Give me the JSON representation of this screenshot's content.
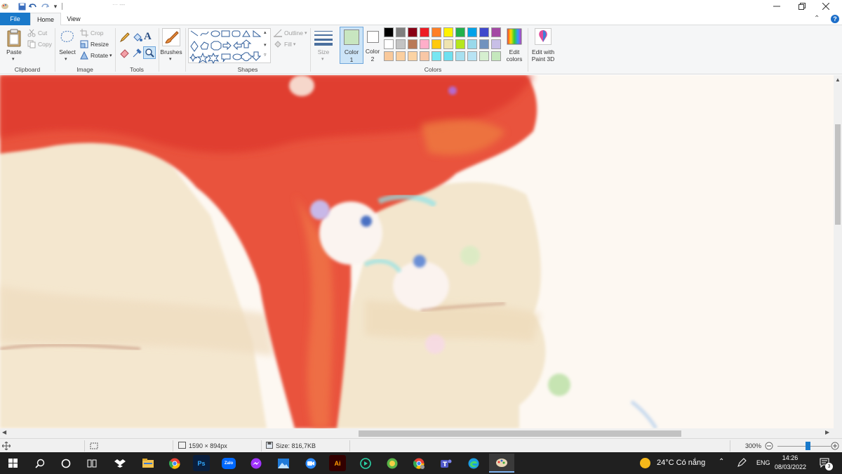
{
  "app": {
    "title_fragment": "··· ---"
  },
  "tabs": {
    "file": "File",
    "home": "Home",
    "view": "View"
  },
  "ribbon": {
    "clipboard": {
      "group_label": "Clipboard",
      "paste": "Paste",
      "cut": "Cut",
      "copy": "Copy"
    },
    "image": {
      "group_label": "Image",
      "select": "Select",
      "crop": "Crop",
      "resize": "Resize",
      "rotate": "Rotate"
    },
    "tools": {
      "group_label": "Tools",
      "text_tool": "A"
    },
    "brushes": {
      "label": "Brushes"
    },
    "shapes": {
      "group_label": "Shapes",
      "outline": "Outline",
      "fill": "Fill"
    },
    "size": {
      "label": "Size"
    },
    "colors": {
      "group_label": "Colors",
      "color1_label": "Color",
      "color1_num": "1",
      "color2_label": "Color",
      "color2_num": "2",
      "edit_colors_1": "Edit",
      "edit_colors_2": "colors",
      "edit_paint3d_1": "Edit with",
      "edit_paint3d_2": "Paint 3D",
      "color1_value": "#c8e6c0",
      "color2_value": "#ffffff",
      "row1": [
        "#000000",
        "#7f7f7f",
        "#880015",
        "#ed1c24",
        "#ff7f27",
        "#fff200",
        "#22b14c",
        "#00a2e8",
        "#3f48cc",
        "#a349a4"
      ],
      "row2": [
        "#ffffff",
        "#c3c3c3",
        "#b97a57",
        "#ffaec9",
        "#ffc90e",
        "#efe4b0",
        "#b5e61d",
        "#99d9ea",
        "#7092be",
        "#c8bfe7"
      ],
      "row3": [
        "#f9c99b",
        "#fbcf9f",
        "#fbd3a4",
        "#f9c7a6",
        "#77e6f2",
        "#6fe0f0",
        "#a8e0f0",
        "#b8e3f4",
        "#d6efd0",
        "#c5e8bd"
      ]
    }
  },
  "status": {
    "dimensions": "1590 × 894px",
    "size": "Size: 816,7KB",
    "zoom": "300%"
  },
  "taskbar": {
    "zalo": "Zalo",
    "ps": "Ps",
    "ai": "Ai",
    "weather": "24°C  Có nắng",
    "lang": "ENG",
    "time": "14:26",
    "date": "08/03/2022",
    "notif_count": "3"
  }
}
